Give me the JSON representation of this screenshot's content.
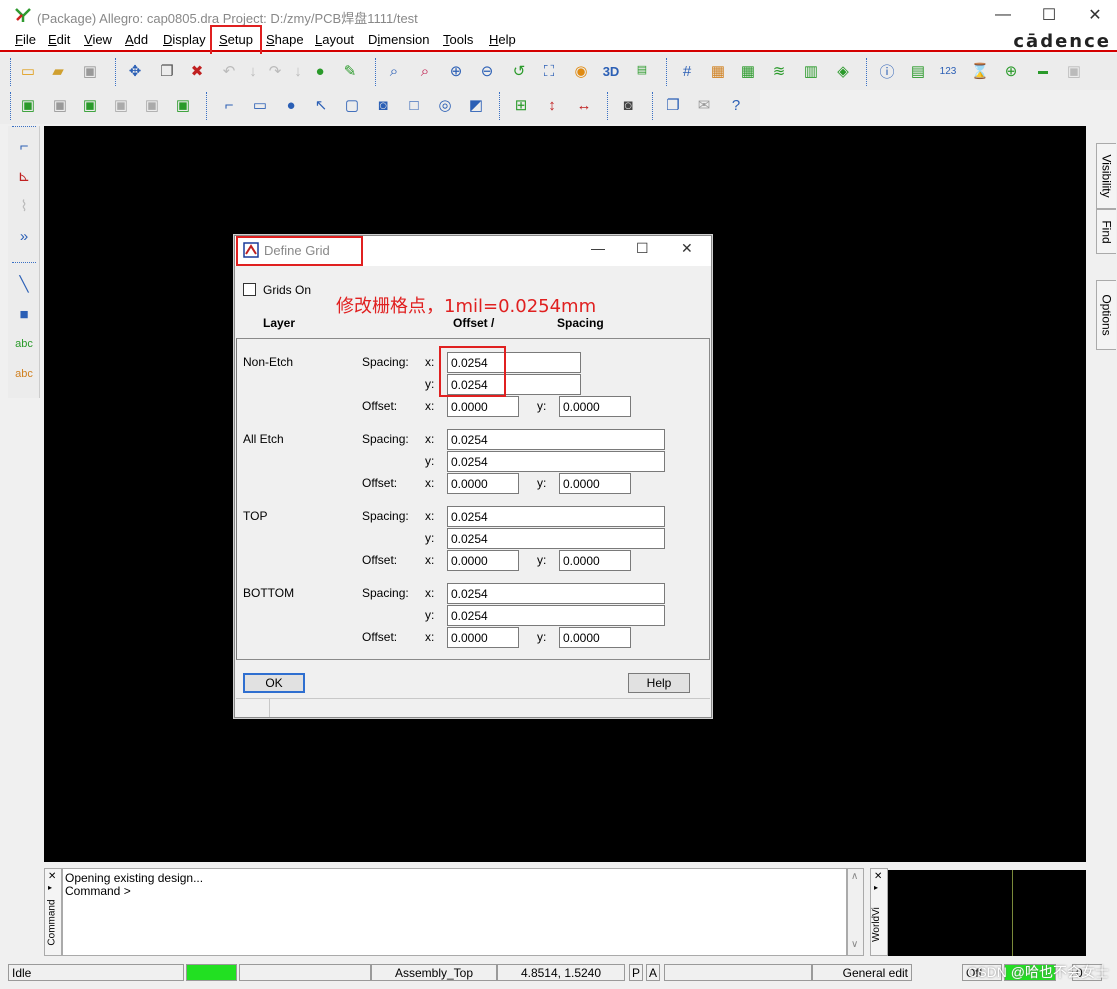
{
  "window": {
    "title": "(Package) Allegro: cap0805.dra  Project: D:/zmy/PCB焊盘1111/test",
    "minimize": "—",
    "maximize": "☐",
    "close": "✕"
  },
  "menu": {
    "items": [
      {
        "ul": "F",
        "rest": "ile"
      },
      {
        "ul": "E",
        "rest": "dit"
      },
      {
        "ul": "V",
        "rest": "iew"
      },
      {
        "ul": "A",
        "rest": "dd"
      },
      {
        "ul": "D",
        "rest": "isplay"
      },
      {
        "ul": "S",
        "rest": "etup"
      },
      {
        "ul": "S",
        "rest": "hape"
      },
      {
        "ul": "L",
        "rest": "ayout"
      },
      {
        "pre": "D",
        "ul": "i",
        "rest": "mension"
      },
      {
        "ul": "T",
        "rest": "ools"
      },
      {
        "ul": "H",
        "rest": "elp"
      }
    ],
    "brand": "cādence"
  },
  "side_tabs": {
    "visibility": "Visibility",
    "find": "Find",
    "options": "Options"
  },
  "dialog": {
    "title": "Define Grid",
    "grids_on_label": "Grids On",
    "annotation": "修改栅格点，1mil=0.0254mm",
    "header_layer": "Layer",
    "header_offset_spacing": "Offset   /",
    "header_spacing": "Spacing",
    "spacing_label": "Spacing:",
    "offset_label": "Offset:",
    "x_label": "x:",
    "y_label": "y:",
    "sections": [
      {
        "name": "Non-Etch",
        "spacing_x": "0.0254",
        "spacing_y": "0.0254",
        "offset_x": "0.0000",
        "offset_y": "0.0000"
      },
      {
        "name": "All Etch",
        "spacing_x": "0.0254",
        "spacing_y": "0.0254",
        "offset_x": "0.0000",
        "offset_y": "0.0000"
      },
      {
        "name": "TOP",
        "spacing_x": "0.0254",
        "spacing_y": "0.0254",
        "offset_x": "0.0000",
        "offset_y": "0.0000"
      },
      {
        "name": "BOTTOM",
        "spacing_x": "0.0254",
        "spacing_y": "0.0254",
        "offset_x": "0.0000",
        "offset_y": "0.0000"
      }
    ],
    "ok_label": "OK",
    "help_label": "Help"
  },
  "command": {
    "tab_label": "Command",
    "lines": [
      "Opening existing design...",
      "Command >"
    ],
    "world_tab_label": "WorldVi"
  },
  "status": {
    "idle": "Idle",
    "layer": "Assembly_Top",
    "coords": "4.8514, 1.5240",
    "p": "P",
    "a": "A",
    "mode": "General edit",
    "off": "Off",
    "count": "0"
  },
  "watermark": "CSDN @哈也不会女士",
  "colors": {
    "highlight": "#e02020",
    "canvas": "#000000",
    "status_green": "#22e022"
  }
}
